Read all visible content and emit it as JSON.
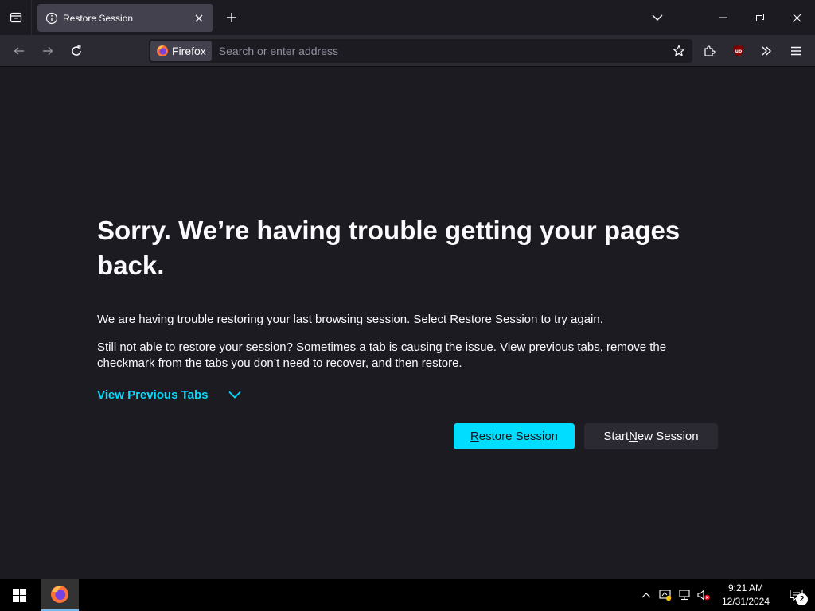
{
  "browser": {
    "tab_title": "Restore Session",
    "identity_label": "Firefox",
    "url_placeholder": "Search or enter address"
  },
  "page": {
    "heading": "Sorry. We’re having trouble getting your pages back.",
    "para1": "We are having trouble restoring your last browsing session. Select Restore Session to try again.",
    "para2": "Still not able to restore your session? Sometimes a tab is causing the issue. View previous tabs, remove the checkmark from the tabs you don’t need to recover, and then restore.",
    "view_previous_tabs": "View Previous Tabs",
    "restore_button": {
      "pre": "",
      "accel": "R",
      "post": "estore Session"
    },
    "new_session_button": {
      "pre": "Start ",
      "accel": "N",
      "post": "ew Session"
    }
  },
  "taskbar": {
    "time": "9:21 AM",
    "date": "12/31/2024",
    "notification_count": "2"
  },
  "colors": {
    "accent": "#00ddff",
    "background": "#1c1b22",
    "toolbar": "#2b2a33"
  }
}
